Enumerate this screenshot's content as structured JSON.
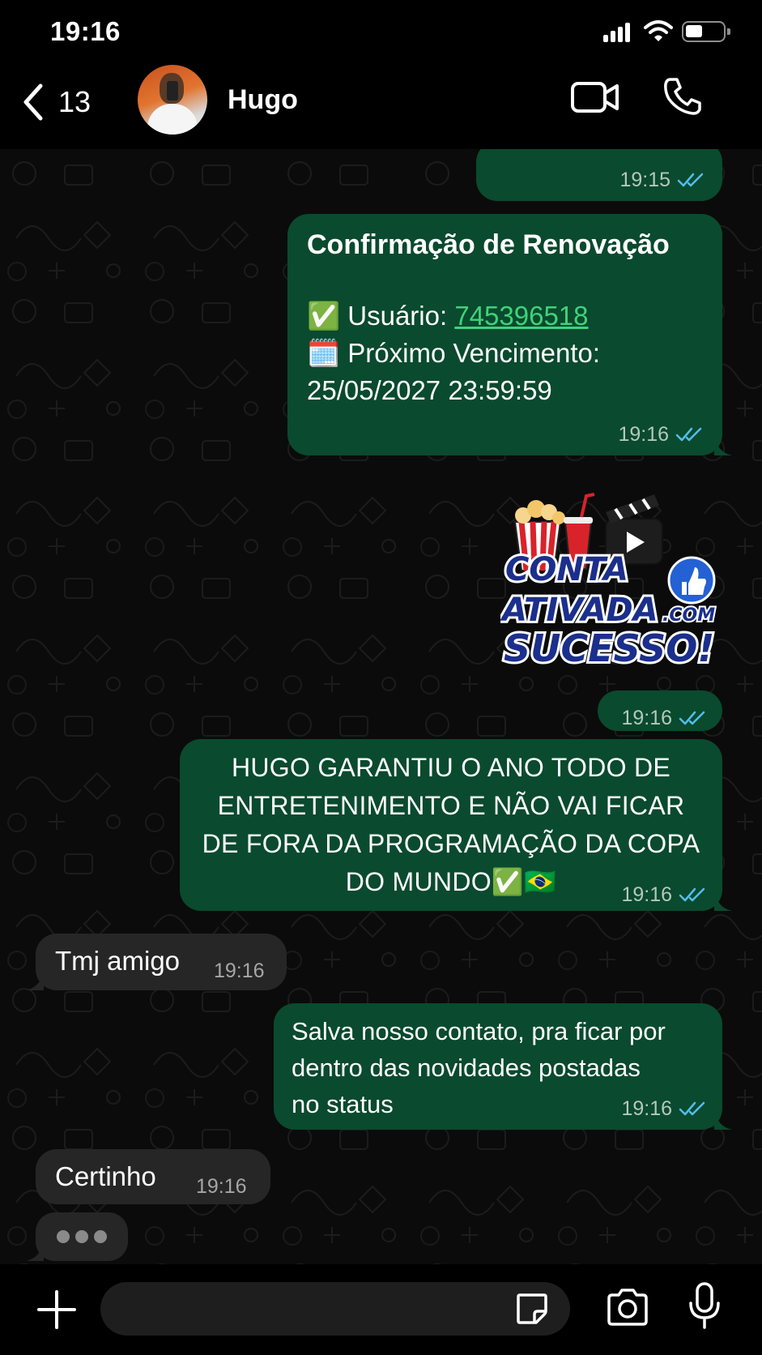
{
  "status_bar": {
    "time": "19:16",
    "battery_level": 0.45
  },
  "header": {
    "back_count": "13",
    "contact_name": "Hugo",
    "icons": [
      "chevron-left-icon",
      "video-call-icon",
      "phone-call-icon"
    ]
  },
  "messages": [
    {
      "direction": "out",
      "time": "19:15",
      "status": "read"
    },
    {
      "direction": "out",
      "title": "Confirmação de Renovação",
      "user_emoji": "✅",
      "user_label": "Usuário: ",
      "user_value": "745396518",
      "due_emoji": "🗓️",
      "due_label": "Próximo Vencimento:",
      "due_value": "25/05/2027 23:59:59",
      "time": "19:16",
      "status": "read"
    },
    {
      "direction": "out",
      "type": "sticker",
      "sticker_line1": "CONTA",
      "sticker_line2": "ATIVADA",
      "sticker_suffix": ".COM",
      "sticker_line3": "SUCESSO!",
      "time": "19:16",
      "status": "read"
    },
    {
      "direction": "out",
      "text": "HUGO GARANTIU O ANO TODO DE ENTRETENIMENTO E NÃO VAI FICAR DE FORA DA PROGRAMAÇÃO DA COPA DO MUNDO✅🇧🇷",
      "time": "19:16",
      "status": "read"
    },
    {
      "direction": "in",
      "text": "Tmj amigo",
      "time": "19:16"
    },
    {
      "direction": "out",
      "text": "Salva nosso contato, pra ficar por dentro das novidades postadas no status",
      "time": "19:16",
      "status": "read"
    },
    {
      "direction": "in",
      "text": "Certinho",
      "time": "19:16"
    }
  ],
  "typing_indicator": true,
  "input_bar": {
    "placeholder": "",
    "icons": [
      "plus-icon",
      "sticker-icon",
      "camera-icon",
      "microphone-icon"
    ]
  },
  "colors": {
    "outgoing_bubble": "#0a4a2e",
    "incoming_bubble": "#262626",
    "read_ticks": "#53bdeb",
    "link": "#3fd27a"
  }
}
